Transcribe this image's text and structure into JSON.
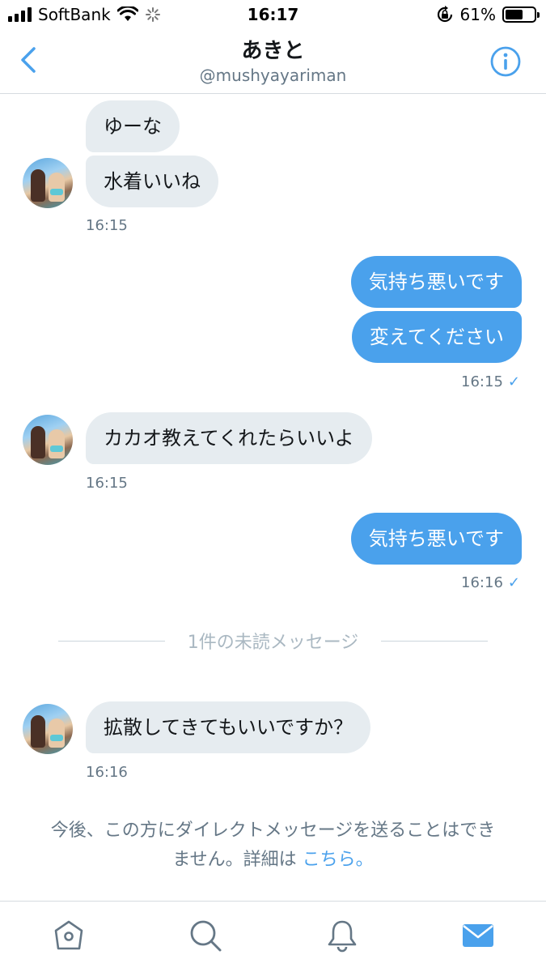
{
  "status_bar": {
    "carrier": "SoftBank",
    "time": "16:17",
    "battery": "61%",
    "battery_level": 0.61,
    "icons": [
      "signal-icon",
      "wifi-icon",
      "loading-spinner-icon",
      "rotation-lock-icon",
      "battery-icon"
    ]
  },
  "header": {
    "title": "あきと",
    "handle": "@mushyayariman",
    "icons": [
      "back-chevron-icon",
      "info-icon"
    ]
  },
  "messages": [
    {
      "direction": "in",
      "text": "ゆーな"
    },
    {
      "direction": "in",
      "text": "水着いいね",
      "time": "16:15"
    },
    {
      "direction": "out",
      "text": "気持ち悪いです"
    },
    {
      "direction": "out",
      "text": "変えてください",
      "time": "16:15"
    },
    {
      "direction": "in",
      "text": "カカオ教えてくれたらいいよ",
      "time": "16:15"
    },
    {
      "direction": "out",
      "text": "気持ち悪いです",
      "time": "16:16"
    },
    {
      "direction": "in",
      "text": "拡散してきてもいいですか？",
      "time": "16:16"
    }
  ],
  "divider": "1件の未読メッセージ",
  "notice": {
    "line1": "今後、この方にダイレクトメッセージを送ることはでき",
    "line2": "ません。詳細は",
    "link": "こちら。"
  },
  "tabbar": {
    "icons": [
      "home-icon",
      "search-icon",
      "notifications-icon",
      "messages-icon"
    ],
    "active": "messages",
    "active_color": "#4aa1ec",
    "inactive_color": "#657786"
  },
  "colors": {
    "incoming_bubble": "#e6ecf0",
    "outgoing_bubble": "#4aa1ec",
    "accent": "#4aa1ec"
  }
}
